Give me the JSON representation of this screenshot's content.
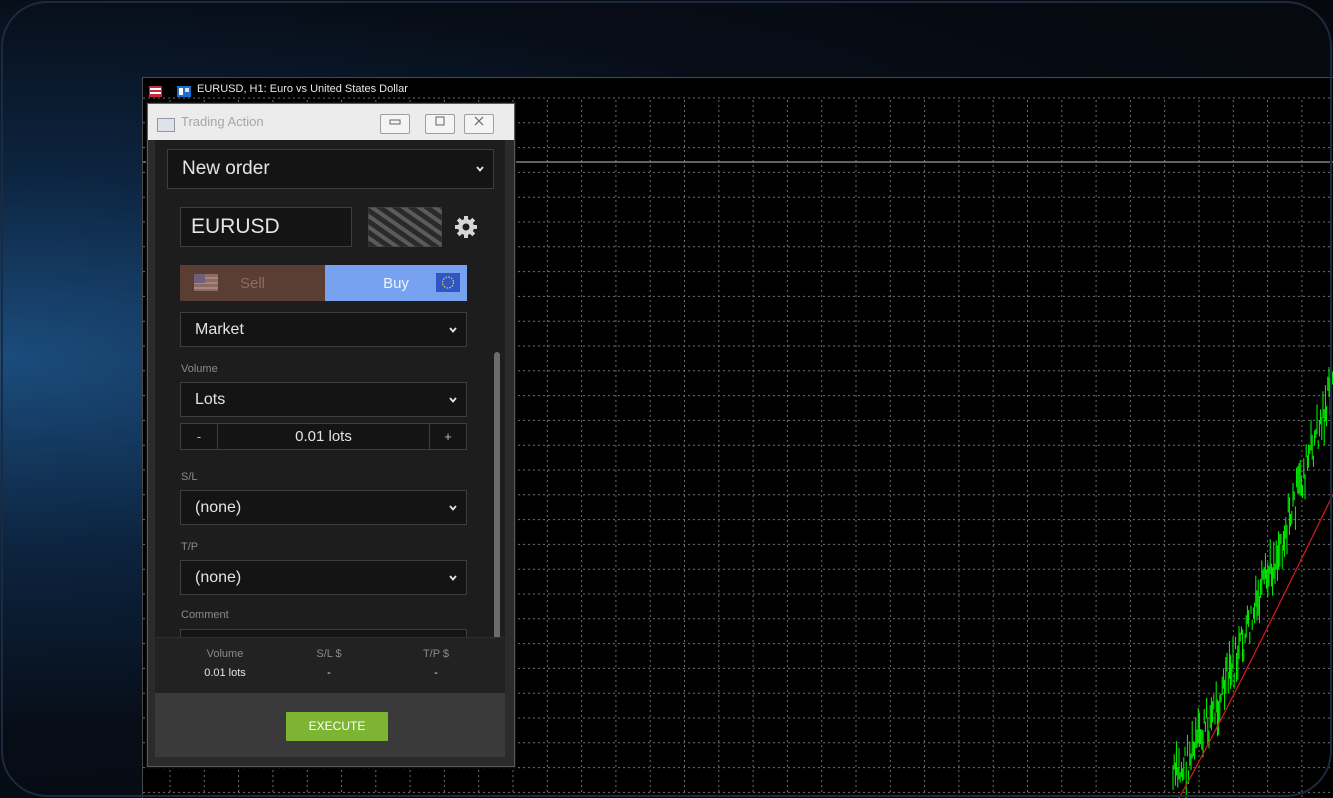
{
  "chart": {
    "title": "EURUSD, H1: Euro vs United States Dollar",
    "background": "#000000",
    "grid_color": "#6e6e6e",
    "bull_color": "#00ff00",
    "ma_color": "#d01e1e"
  },
  "trading_action": {
    "window_title": "Trading Action",
    "order_type_selected": "New order",
    "symbol": "EURUSD",
    "sell_label": "Sell",
    "buy_label": "Buy",
    "execution_selected": "Market",
    "volume_label": "Volume",
    "volume_unit_selected": "Lots",
    "volume_minus": "-",
    "volume_value": "0.01 lots",
    "volume_plus": "+",
    "sl_label": "S/L",
    "sl_selected": "(none)",
    "tp_label": "T/P",
    "tp_selected": "(none)",
    "comment_label": "Comment",
    "summary": {
      "volume_header": "Volume",
      "volume_value": "0.01 lots",
      "sl_header": "S/L $",
      "sl_value": "-",
      "tp_header": "T/P $",
      "tp_value": "-"
    },
    "execute_label": "EXECUTE",
    "colors": {
      "buy_active": "#76a2f0",
      "sell_inactive": "#5a3d33",
      "execute": "#7db533"
    }
  },
  "icons": {
    "settings": "gear-icon",
    "sell_flag": "usa-flag-icon",
    "buy_flag": "eu-flag-icon",
    "dropdown": "chevron-down-icon"
  }
}
